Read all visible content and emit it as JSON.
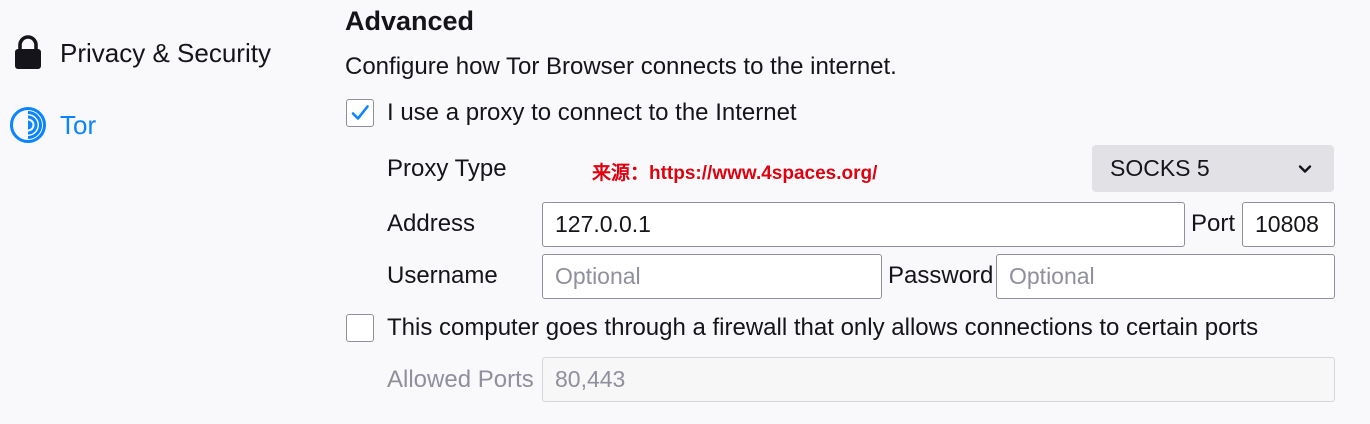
{
  "sidebar": {
    "items": [
      {
        "label": "Privacy & Security",
        "icon": "lock-icon"
      },
      {
        "label": "Tor",
        "icon": "tor-onion-icon"
      }
    ]
  },
  "section": {
    "title": "Advanced",
    "description": "Configure how Tor Browser connects to the internet."
  },
  "proxy": {
    "use_proxy_label": "I use a proxy to connect to the Internet",
    "use_proxy_checked": true,
    "type_label": "Proxy Type",
    "type_value": "SOCKS 5",
    "address_label": "Address",
    "address_value": "127.0.0.1",
    "port_label": "Port",
    "port_value": "10808",
    "username_label": "Username",
    "username_placeholder": "Optional",
    "password_label": "Password",
    "password_placeholder": "Optional"
  },
  "firewall": {
    "label": "This computer goes through a firewall that only allows connections to certain ports",
    "checked": false,
    "allowed_ports_label": "Allowed Ports",
    "allowed_ports_value": "80,443"
  },
  "watermark": "来源：https://www.4spaces.org/",
  "colors": {
    "accent": "#0a84ff",
    "background": "#f9f9fb",
    "dropdown_bg": "#e2e2e6",
    "watermark": "#e0000f"
  }
}
